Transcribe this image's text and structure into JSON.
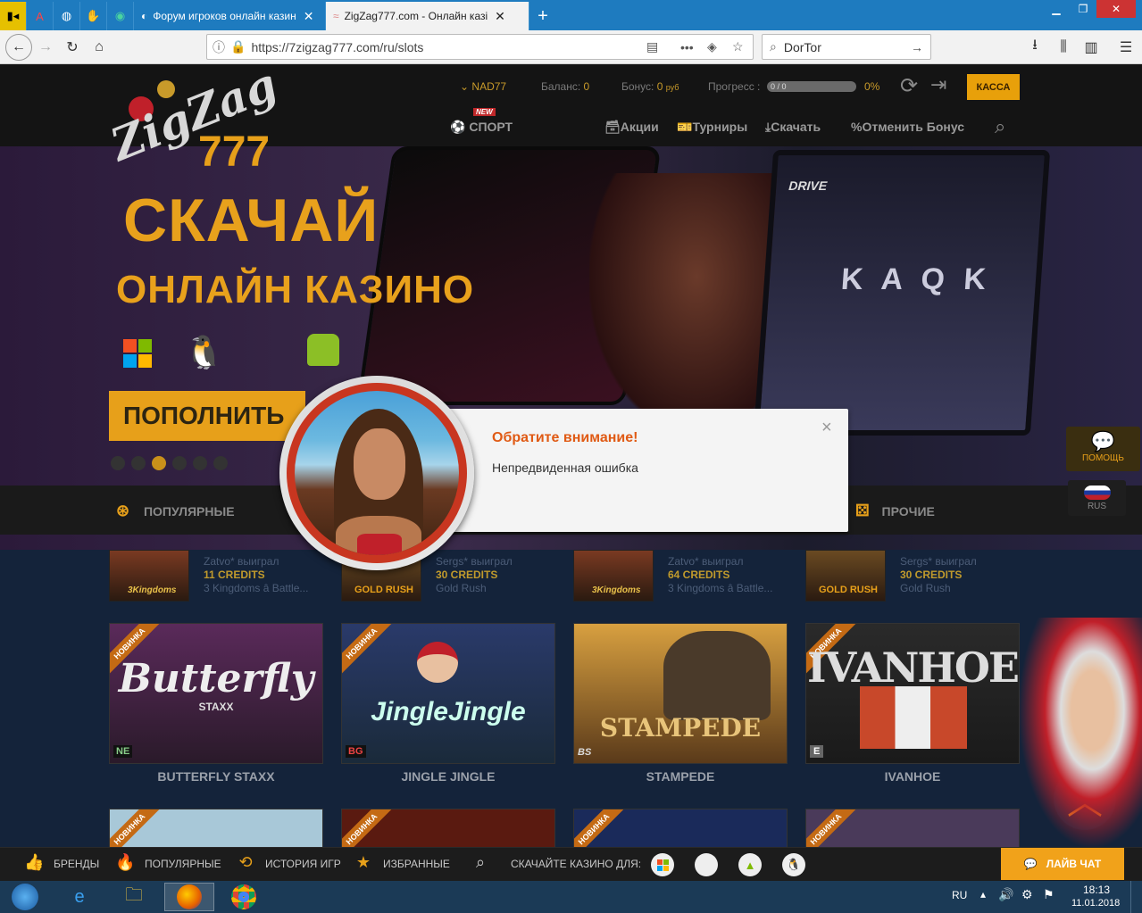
{
  "browser": {
    "tabs": [
      {
        "title": "Форум игроков онлайн казин",
        "active": false
      },
      {
        "title": "ZigZag777.com - Онлайн казі",
        "active": true
      }
    ],
    "url": "https://7zigzag777.com/ru/slots",
    "search_value": "DorTor"
  },
  "header": {
    "user": "NAD77",
    "balance_label": "Баланс:",
    "balance_value": "0",
    "bonus_label": "Бонус:",
    "bonus_value": "0",
    "bonus_unit": "руб",
    "progress_label": "Прогресс :",
    "progress_value": "0 / 0",
    "progress_percent_label": "0%",
    "progress_fraction": 0,
    "kassa": "КАССА",
    "sport_badge": "NEW",
    "sport": "СПОРТ",
    "nav": [
      "Акции",
      "Турниры",
      "Скачать",
      "Отменить Бонус"
    ]
  },
  "hero": {
    "title_line1": "СКАЧАЙ",
    "title_line2": "ОНЛАЙН КАЗИНО",
    "cta": "ПОПОЛНИТЬ",
    "active_dot": 2,
    "dot_count": 6,
    "slot_brand": "DRIVE",
    "reels_text": "K A Q K"
  },
  "categories": {
    "left": "ПОПУЛЯРНЫЕ",
    "right": "ПРОЧИЕ"
  },
  "winners": [
    {
      "user": "Zatvo* выиграл",
      "amount": "11 CREDITS",
      "game": "3 Kingdoms â Battle...",
      "thumb_text": "3Kingdoms"
    },
    {
      "user": "Sergs* выиграл",
      "amount": "30 CREDITS",
      "game": "Gold Rush",
      "thumb_text": "GOLD RUSH"
    },
    {
      "user": "Zatvo* выиграл",
      "amount": "64 CREDITS",
      "game": "3 Kingdoms â Battle...",
      "thumb_text": "3Kingdoms"
    },
    {
      "user": "Sergs* выиграл",
      "amount": "30 CREDITS",
      "game": "Gold Rush",
      "thumb_text": "GOLD RUSH"
    }
  ],
  "games": [
    {
      "name": "BUTTERFLY STAXX",
      "ribbon": "НОВИНКА",
      "art": "Butterfly",
      "art_sub": "STAXX",
      "provider": "NE"
    },
    {
      "name": "JINGLE JINGLE",
      "ribbon": "НОВИНКА",
      "art": "JingleJingle",
      "art_sub": "",
      "provider": "BG"
    },
    {
      "name": "STAMPEDE",
      "ribbon": "",
      "art": "STAMPEDE",
      "art_sub": "",
      "provider": "BS"
    },
    {
      "name": "IVANHOE",
      "ribbon": "НОВИНКА",
      "art": "IVANHOE",
      "art_sub": "",
      "provider": "E"
    }
  ],
  "games_row2_ribbons": [
    "НОВИНКА",
    "НОВИНКА",
    "НОВИНКА",
    "НОВИНКА"
  ],
  "modal": {
    "title": "Обратите внимание!",
    "message": "Непредвиденная ошибка",
    "close": "×"
  },
  "side": {
    "help": "ПОМОЩЬ",
    "lang": "RUS"
  },
  "footer": {
    "brands": "БРЕНДЫ",
    "popular": "ПОПУЛЯРНЫЕ",
    "history": "ИСТОРИЯ ИГР",
    "favorites": "ИЗБРАННЫЕ",
    "download": "СКАЧАЙТЕ КАЗИНО ДЛЯ:",
    "livechat": "ЛАЙВ ЧАТ"
  },
  "taskbar": {
    "lang": "RU",
    "time": "18:13",
    "date": "11.01.2018"
  },
  "colors": {
    "accent": "#e7a01a",
    "modal_title": "#e05a14",
    "browser_tabbar": "#1e7bbf"
  }
}
